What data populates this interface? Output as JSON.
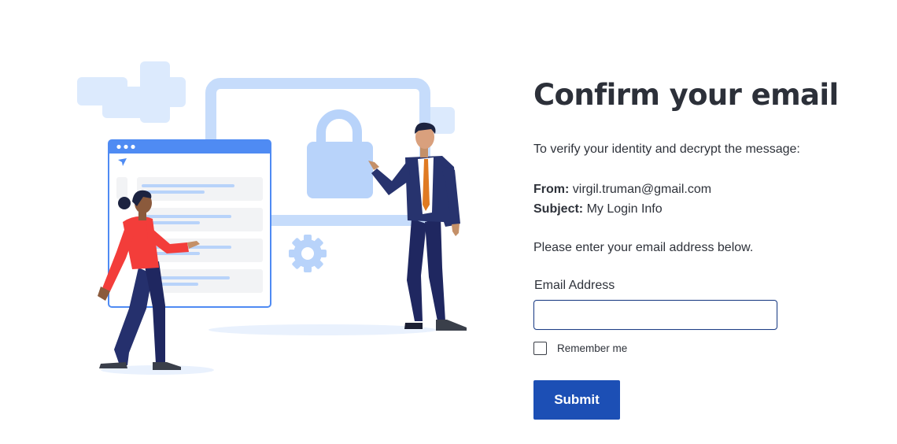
{
  "form": {
    "title": "Confirm your email",
    "intro": "To verify your identity and decrypt the message:",
    "from_label": "From:",
    "from_value": "virgil.truman@gmail.com",
    "subject_label": "Subject:",
    "subject_value": "My Login Info",
    "instruction": "Please enter your email address below.",
    "email_label": "Email Address",
    "email_value": "",
    "email_placeholder": "",
    "remember_label": "Remember me",
    "remember_checked": false,
    "submit_label": "Submit"
  },
  "illustration": {
    "icons": [
      "lock-icon",
      "gear-icon",
      "send-icon"
    ],
    "colors": {
      "light_blue": "#dbe9fd",
      "mid_blue": "#b8d3fa",
      "accent_blue": "#4f8bf3",
      "woman_shirt": "#f33d3a",
      "navy": "#25306d",
      "tie": "#e07a22"
    }
  },
  "colors": {
    "title": "#2c3039",
    "text": "#2e323a",
    "input_border": "#1f3f86",
    "button": "#1c4fb5",
    "button_text": "#ffffff"
  }
}
